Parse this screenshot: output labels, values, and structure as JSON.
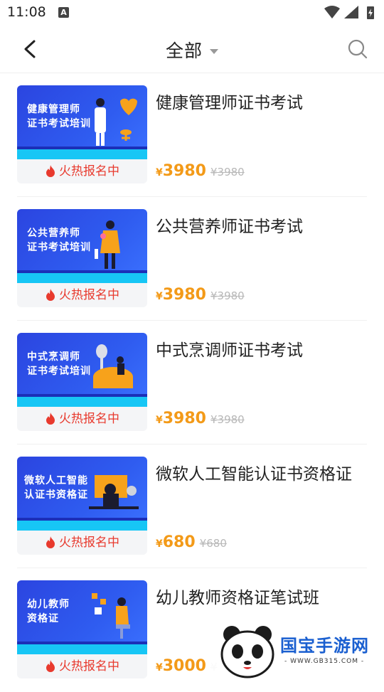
{
  "status_bar": {
    "time": "11:08",
    "notification_icon": "A"
  },
  "header": {
    "title": "全部",
    "back_icon": "chevron-left-icon",
    "search_icon": "search-icon"
  },
  "courses": [
    {
      "title": "健康管理师证书考试",
      "banner_line1": "健康管理师",
      "banner_line2": "证书考试培训",
      "tag": "火热报名中",
      "yen": "¥",
      "price": "3980",
      "original_price": "¥3980"
    },
    {
      "title": "公共营养师证书考试",
      "banner_line1": "公共营养师",
      "banner_line2": "证书考试培训",
      "tag": "火热报名中",
      "yen": "¥",
      "price": "3980",
      "original_price": "¥3980"
    },
    {
      "title": "中式烹调师证书考试",
      "banner_line1": "中式烹调师",
      "banner_line2": "证书考试培训",
      "tag": "火热报名中",
      "yen": "¥",
      "price": "3980",
      "original_price": "¥3980"
    },
    {
      "title": "微软人工智能认证书资格证",
      "banner_line1": "微软人工智能",
      "banner_line2": "认证书资格证",
      "tag": "火热报名中",
      "yen": "¥",
      "price": "680",
      "original_price": "¥680"
    },
    {
      "title": "幼儿教师资格证笔试班",
      "banner_line1": "幼儿教师",
      "banner_line2": "资格证",
      "tag": "火热报名中",
      "yen": "¥",
      "price": "3000",
      "original_price": "¥"
    }
  ],
  "watermark": {
    "name": "国宝手游网",
    "url": "- WWW.GB315.COM -"
  },
  "colors": {
    "price": "#f39a18",
    "hot_tag": "#e83a2e",
    "banner_blue": "#2f5cf0",
    "banner_cyan": "#17c6f5",
    "watermark_blue": "#1a5fd0"
  }
}
